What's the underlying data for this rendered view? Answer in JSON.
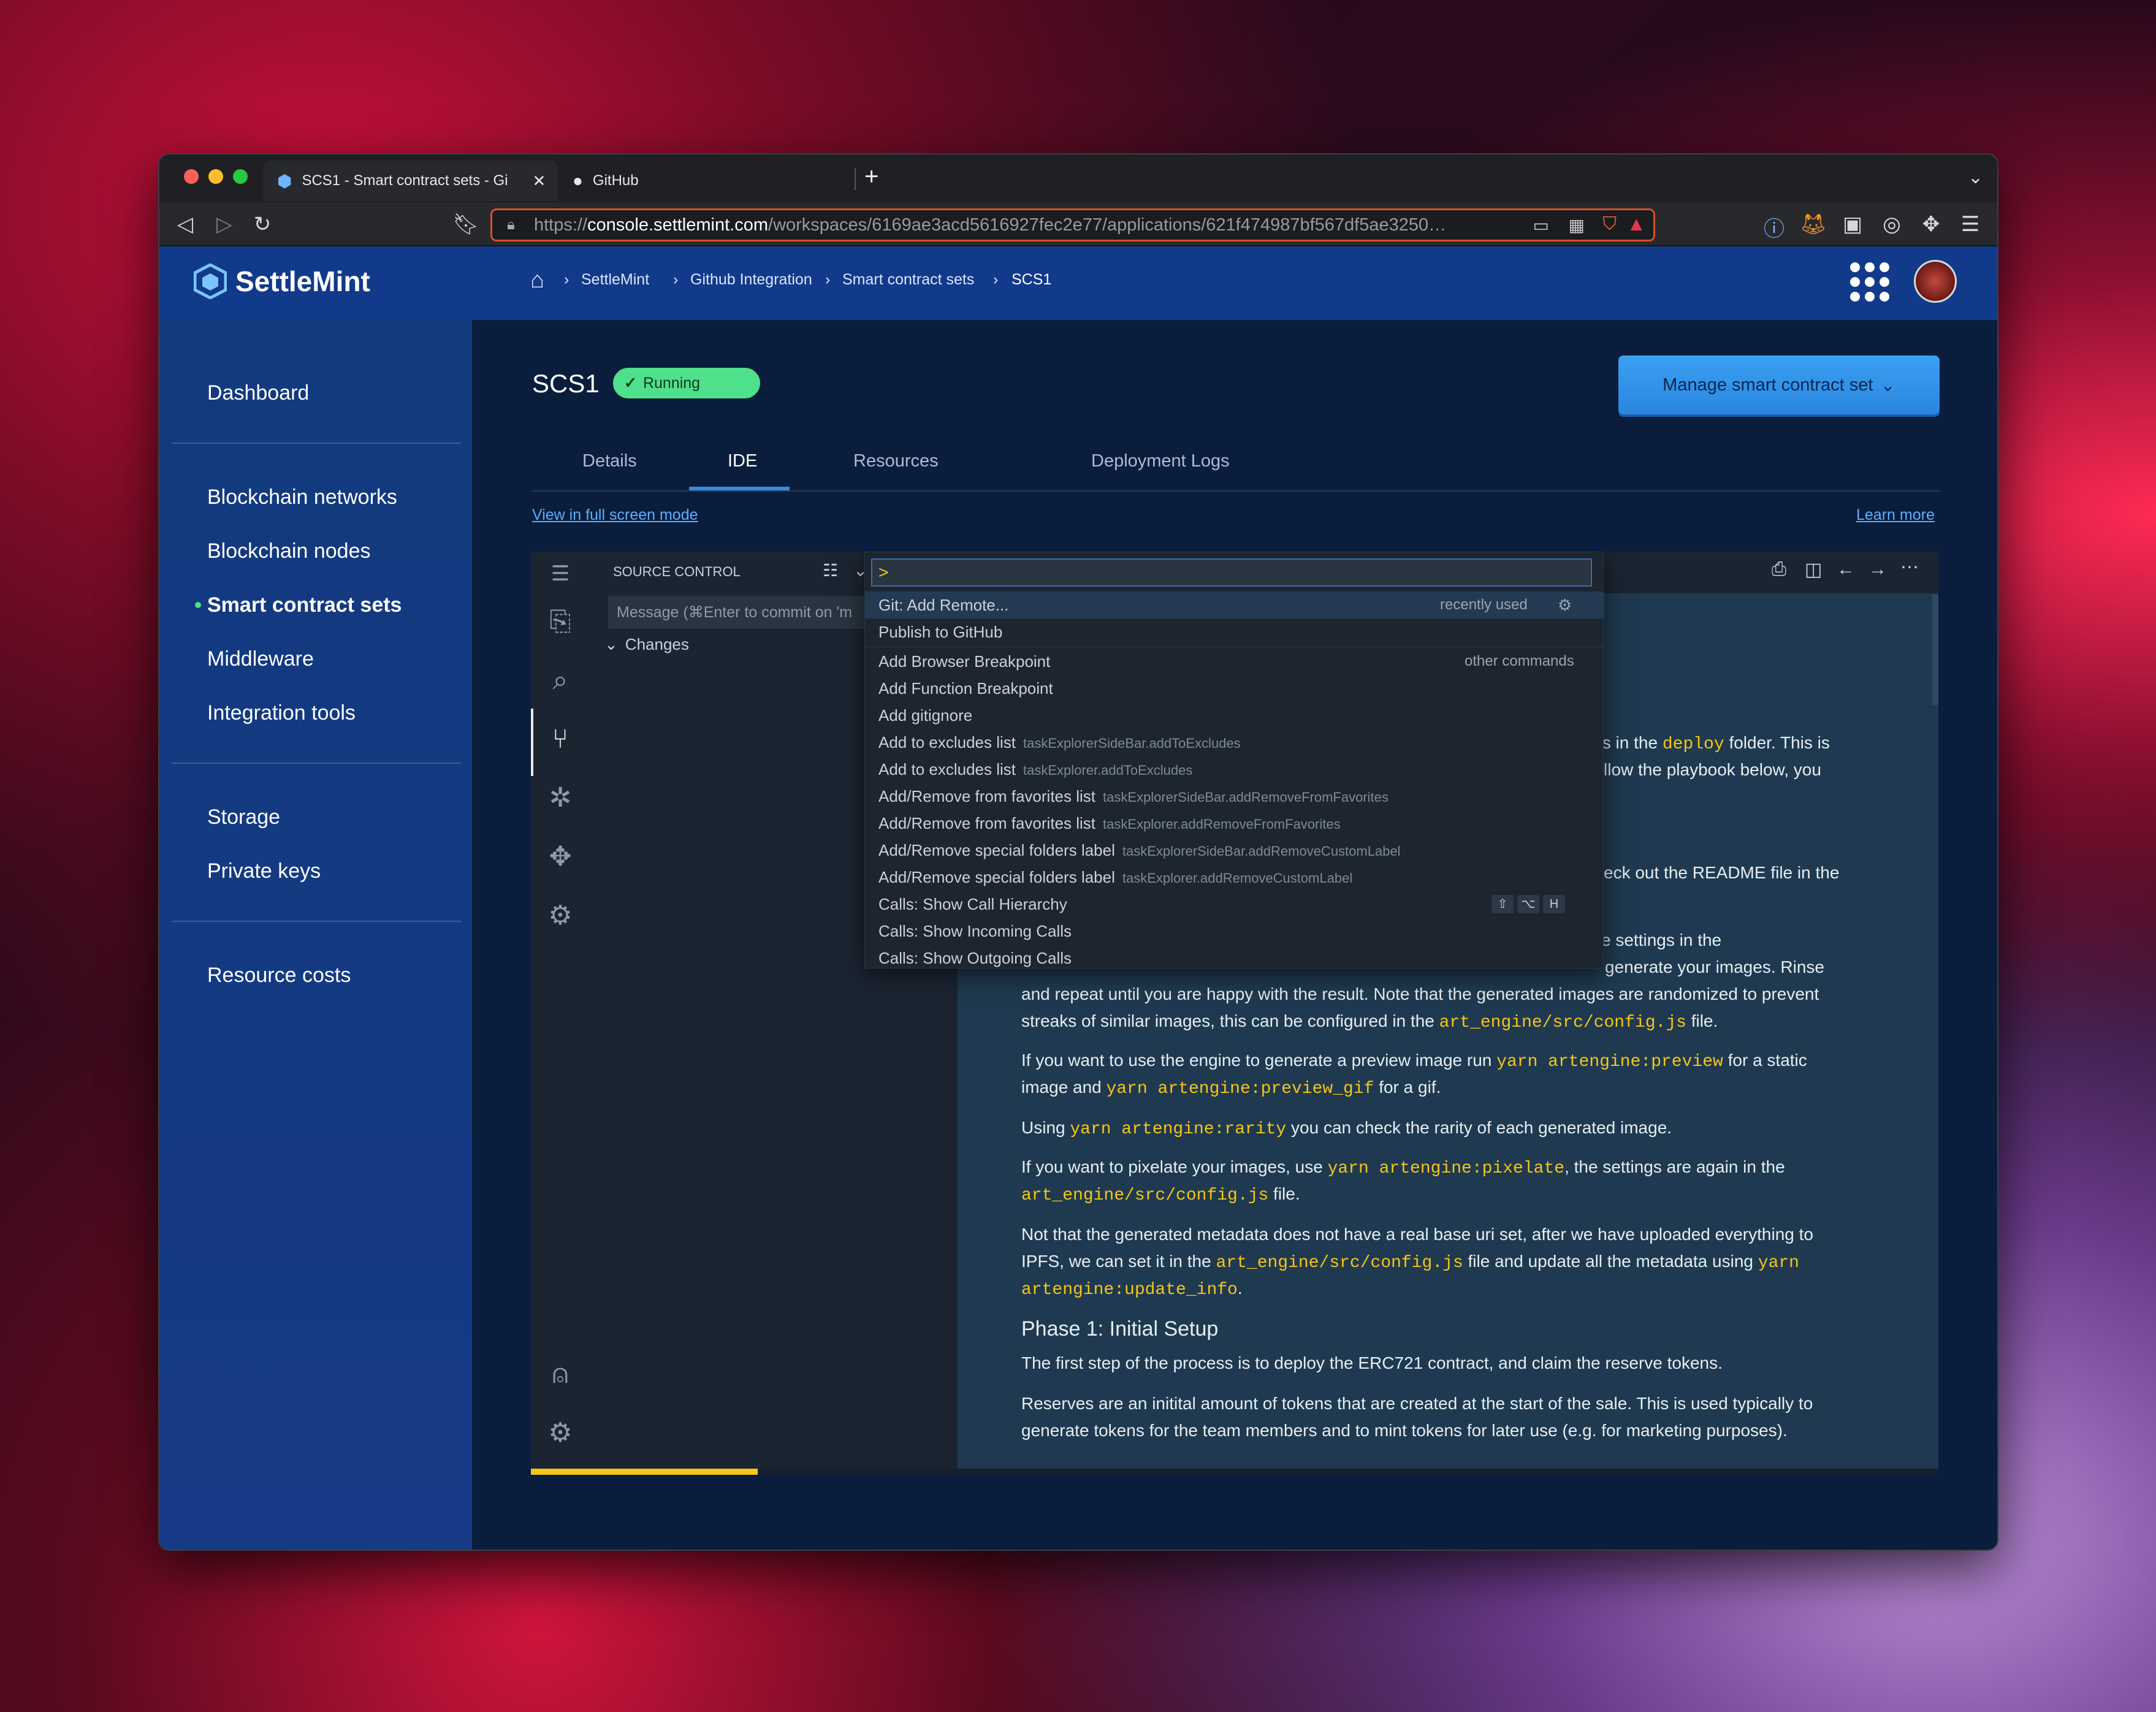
{
  "browser": {
    "tabs": [
      {
        "label": "SCS1 - Smart contract sets - Gi"
      },
      {
        "label": "GitHub"
      }
    ],
    "new_tab": "+",
    "url_prefix": "https://",
    "url_domain": "console.settlemint.com",
    "url_path": "/workspaces/6169ae3acd5616927fec2e77/applications/621f474987bf567df5ae3250…"
  },
  "header": {
    "brand": "SettleMint",
    "breadcrumb": [
      "SettleMint",
      "Github Integration",
      "Smart contract sets",
      "SCS1"
    ]
  },
  "sidebar": {
    "items": [
      "Dashboard",
      "Blockchain networks",
      "Blockchain nodes",
      "Smart contract sets",
      "Middleware",
      "Integration tools",
      "Storage",
      "Private keys",
      "Resource costs"
    ],
    "active": "Smart contract sets"
  },
  "page": {
    "title": "SCS1",
    "status": "Running",
    "manage_button": "Manage smart contract set",
    "tabs": [
      "Details",
      "IDE",
      "Resources",
      "Deployment Logs"
    ],
    "active_tab": "IDE",
    "fullscreen_link": "View in full screen mode",
    "learn_more": "Learn more"
  },
  "ide": {
    "panel_title": "SOURCE CONTROL",
    "commit_placeholder": "Message (⌘Enter to commit on 'm",
    "changes_label": "Changes",
    "palette_input": ">",
    "palette_items": [
      {
        "label": "Git: Add Remote...",
        "cmd": "",
        "tag": "recently used"
      },
      {
        "label": "Publish to GitHub",
        "cmd": "",
        "tag": ""
      },
      {
        "label": "Add Browser Breakpoint",
        "cmd": "",
        "tag": "other commands"
      },
      {
        "label": "Add Function Breakpoint",
        "cmd": "",
        "tag": ""
      },
      {
        "label": "Add gitignore",
        "cmd": "",
        "tag": ""
      },
      {
        "label": "Add to excludes list",
        "cmd": "taskExplorerSideBar.addToExcludes",
        "tag": ""
      },
      {
        "label": "Add to excludes list",
        "cmd": "taskExplorer.addToExcludes",
        "tag": ""
      },
      {
        "label": "Add/Remove from favorites list",
        "cmd": "taskExplorerSideBar.addRemoveFromFavorites",
        "tag": ""
      },
      {
        "label": "Add/Remove from favorites list",
        "cmd": "taskExplorer.addRemoveFromFavorites",
        "tag": ""
      },
      {
        "label": "Add/Remove special folders label",
        "cmd": "taskExplorerSideBar.addRemoveCustomLabel",
        "tag": ""
      },
      {
        "label": "Add/Remove special folders label",
        "cmd": "taskExplorer.addRemoveCustomLabel",
        "tag": ""
      },
      {
        "label": "Calls: Show Call Hierarchy",
        "cmd": "",
        "tag": ""
      },
      {
        "label": "Calls: Show Incoming Calls",
        "cmd": "",
        "tag": ""
      },
      {
        "label": "Calls: Show Outgoing Calls",
        "cmd": "",
        "tag": ""
      }
    ],
    "keybinding": [
      "⇧",
      "⌥",
      "H"
    ],
    "doc": {
      "p1a": "ts in the ",
      "p1code": "deploy",
      "p1b": " folder. This is",
      "p2": "llow the playbook below, you",
      "p3": "eck out the README file in the",
      "p4": "e settings in the",
      "p5": "generate your images. Rinse",
      "p6": "and repeat until you are happy with the result. Note that the generated images are randomized to prevent",
      "p7a": "streaks of similar images, this can be configured in the ",
      "p7code": "art_engine/src/config.js",
      "p7b": " file.",
      "p8a": "If you want to use the engine to generate a preview image run ",
      "p8code": "yarn artengine:preview",
      "p8b": " for a static",
      "p9a": "image and ",
      "p9code": "yarn artengine:preview_gif",
      "p9b": " for a gif.",
      "p10a": "Using ",
      "p10code": "yarn artengine:rarity",
      "p10b": " you can check the rarity of each generated image.",
      "p11a": "If you want to pixelate your images, use ",
      "p11code": "yarn artengine:pixelate",
      "p11b": ", the settings are again in the",
      "p12code": "art_engine/src/config.js",
      "p12b": " file.",
      "p13": "Not that the generated metadata does not have a real base uri set, after we have uploaded everything to",
      "p14a": "IPFS, we can set it in the ",
      "p14code": "art_engine/src/config.js",
      "p14b": " file and update all the metadata using ",
      "p14code2": "yarn",
      "p15code": "artengine:update_info",
      "p15b": ".",
      "h1": "Phase 1: Initial Setup",
      "p16": "The first step of the process is to deploy the ERC721 contract, and claim the reserve tokens.",
      "p17": "Reserves are an initital amount of tokens that are created at the start of the sale. This is used typically to",
      "p18": "generate tokens for the team members and to mint tokens for later use (e.g. for marketing purposes)."
    }
  },
  "colors": {
    "accent": "#2f8ee8",
    "running": "#4ee08a",
    "brand_blue": "#113a8a",
    "code_yellow": "#f5c518",
    "url_border": "#d6502a"
  }
}
